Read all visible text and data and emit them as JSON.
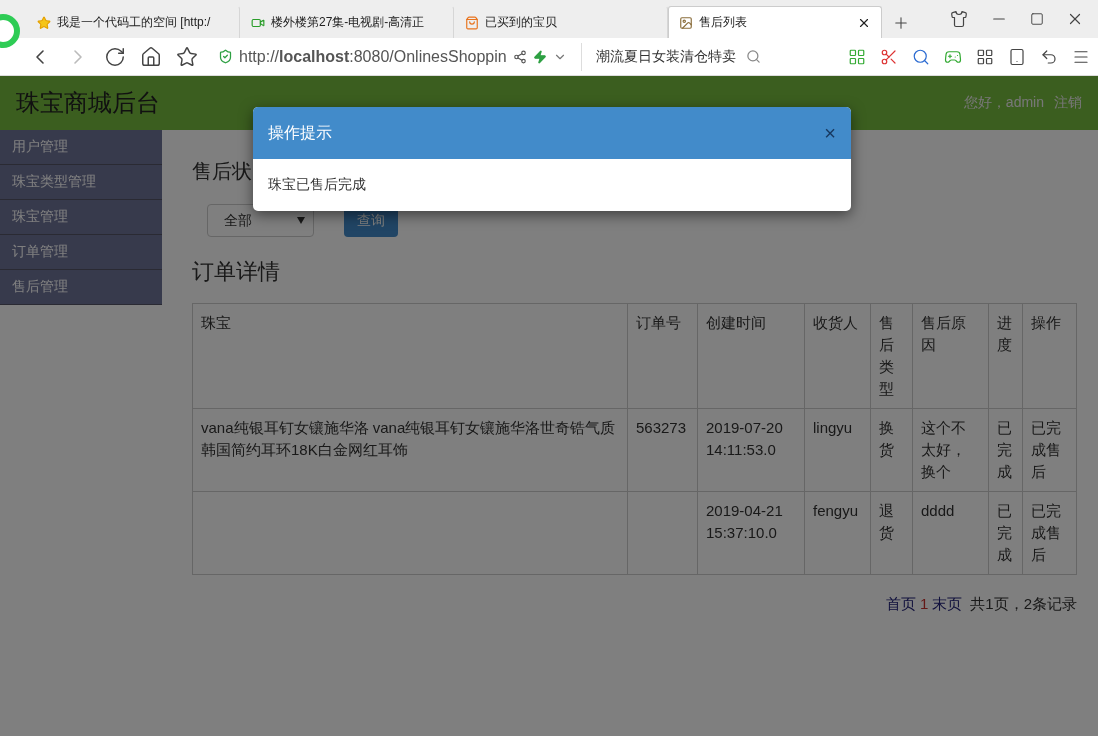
{
  "browser": {
    "tabs": [
      {
        "title": "我是一个代码工的空间 [http:/",
        "selected": false
      },
      {
        "title": "楼外楼第27集-电视剧-高清正",
        "selected": false
      },
      {
        "title": "已买到的宝贝",
        "selected": false
      },
      {
        "title": "售后列表",
        "selected": true
      }
    ],
    "address": {
      "url": "http://**localhost**:8080/OnlinesShoppin"
    },
    "search": {
      "value": "潮流夏日女装清仓特卖"
    }
  },
  "header": {
    "title": "珠宝商城后台",
    "greeting": "您好，admin",
    "logout": "注销"
  },
  "sidebar": {
    "items": [
      {
        "label": "用户管理"
      },
      {
        "label": "珠宝类型管理"
      },
      {
        "label": "珠宝管理"
      },
      {
        "label": "订单管理"
      },
      {
        "label": "售后管理"
      }
    ]
  },
  "content": {
    "heading": "售后状",
    "filter": {
      "value": "全部"
    },
    "query_button": "查询",
    "section_title": "订单详情",
    "table": {
      "columns": [
        "珠宝",
        "订单号",
        "创建时间",
        "收货人",
        "售后类型",
        "售后原因",
        "进度",
        "操作"
      ],
      "rows": [
        {
          "cells": [
            "vana纯银耳钉女镶施华洛  vana纯银耳钉女镶施华洛世奇锆气质韩国简约耳环18K白金网红耳饰",
            "563273",
            "2019-07-20 14:11:53.0",
            "lingyu",
            "换货",
            "这个不太好，换个",
            "已完成",
            "已完成售后"
          ]
        },
        {
          "cells": [
            "",
            "",
            "2019-04-21 15:37:10.0",
            "fengyu",
            "退货",
            "dddd",
            "已完成",
            "已完成售后"
          ]
        }
      ]
    },
    "pagination": {
      "links": [
        {
          "label": "首页",
          "selected": false
        },
        {
          "label": "1",
          "selected": true
        },
        {
          "label": "末页",
          "selected": false
        }
      ],
      "info": "共1页，2条记录"
    }
  },
  "modal": {
    "title": "操作提示",
    "close": "×",
    "message": "珠宝已售后完成"
  }
}
